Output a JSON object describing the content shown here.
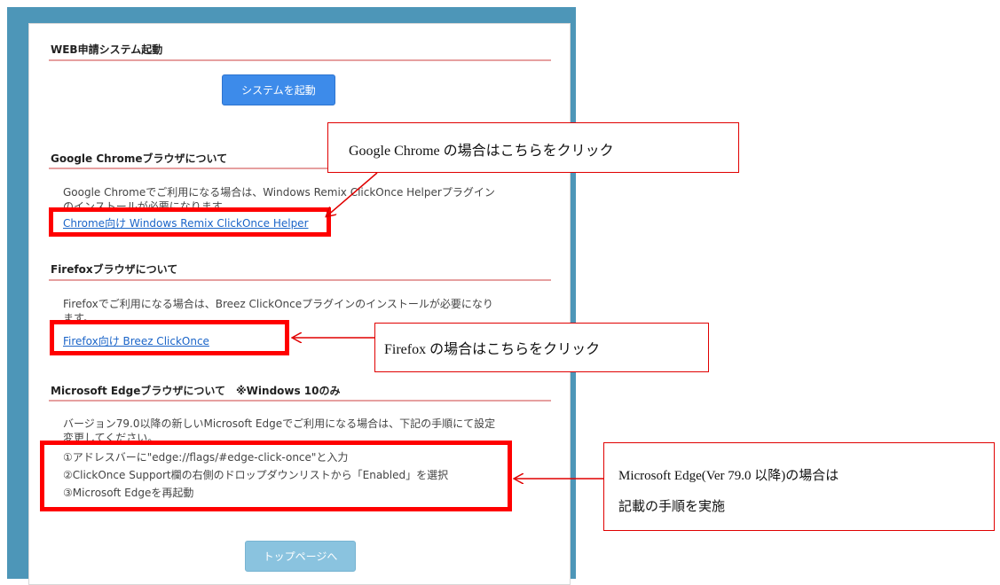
{
  "sections": {
    "launch": {
      "title": "WEB申請システム起動",
      "button": "システムを起動"
    },
    "chrome": {
      "title": "Google Chromeブラウザについて",
      "line1": "Google Chromeでご利用になる場合は、Windows Remix ClickOnce Helperプラグイン",
      "line2": "のインストールが必要になります。",
      "link": "Chrome向け Windows Remix ClickOnce Helper"
    },
    "firefox": {
      "title": "Firefoxブラウザについて",
      "line1": "Firefoxでご利用になる場合は、Breez ClickOnceプラグインのインストールが必要になり",
      "line2": "ます。",
      "link": "Firefox向け Breez ClickOnce"
    },
    "edge": {
      "title": "Microsoft Edgeブラウザについて　※Windows 10のみ",
      "line1": "バージョン79.0以降の新しいMicrosoft Edgeでご利用になる場合は、下記の手順にて設定",
      "line2": "変更してください。",
      "steps": [
        "①アドレスバーに\"edge://flags/#edge-click-once\"と入力",
        "②ClickOnce Support欄の右側のドロップダウンリストから「Enabled」を選択",
        "③Microsoft Edgeを再起動"
      ]
    },
    "footer": {
      "button": "トップページへ"
    }
  },
  "annotations": {
    "chrome_callout": "Google Chrome の場合はこちらをクリック",
    "firefox_callout": "Firefox の場合はこちらをクリック",
    "edge_callout_line1": "Microsoft Edge(Ver 79.0 以降)の場合は",
    "edge_callout_line2": "記載の手順を実施"
  },
  "colors": {
    "frame": "#4d96b8",
    "highlight": "#ff0000",
    "start_button": "#3d8bea",
    "top_button": "#8ac3df",
    "link": "#1a64c8"
  }
}
